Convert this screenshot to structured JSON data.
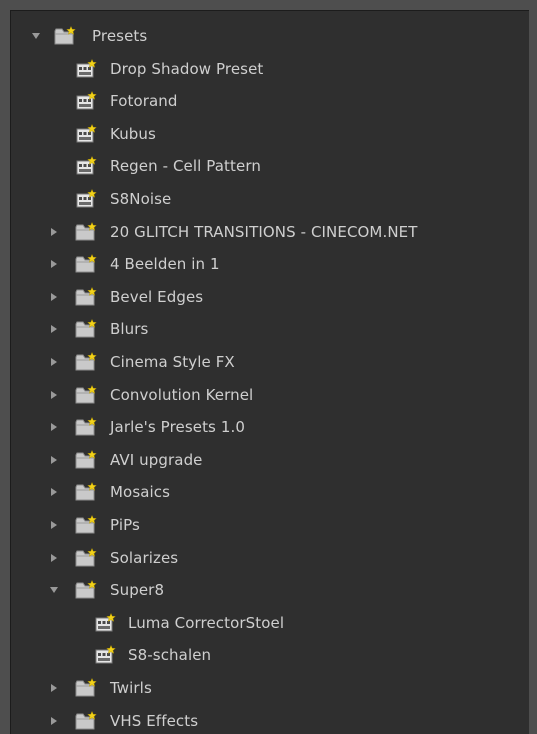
{
  "colors": {
    "panel_bg": "#2f2f2f",
    "text": "#cfcfcf",
    "folder": "#c9c9c9",
    "star": "#f2d21b",
    "twisty": "#9a9a9a"
  },
  "tree": [
    {
      "label": "Presets",
      "level": 0,
      "type": "folder",
      "expanded": true,
      "icon": "folder-star-icon"
    },
    {
      "label": "Drop Shadow Preset",
      "level": 1,
      "type": "preset",
      "icon": "preset-icon"
    },
    {
      "label": "Fotorand",
      "level": 1,
      "type": "preset",
      "icon": "preset-icon"
    },
    {
      "label": "Kubus",
      "level": 1,
      "type": "preset",
      "icon": "preset-icon"
    },
    {
      "label": "Regen - Cell Pattern",
      "level": 1,
      "type": "preset",
      "icon": "preset-icon"
    },
    {
      "label": "S8Noise",
      "level": 1,
      "type": "preset",
      "icon": "preset-icon"
    },
    {
      "label": "20 GLITCH TRANSITIONS - CINECOM.NET",
      "level": 1,
      "type": "folder",
      "expanded": false,
      "icon": "folder-star-icon"
    },
    {
      "label": "4 Beelden in 1",
      "level": 1,
      "type": "folder",
      "expanded": false,
      "icon": "folder-star-icon"
    },
    {
      "label": "Bevel Edges",
      "level": 1,
      "type": "folder",
      "expanded": false,
      "icon": "folder-star-icon"
    },
    {
      "label": "Blurs",
      "level": 1,
      "type": "folder",
      "expanded": false,
      "icon": "folder-star-icon"
    },
    {
      "label": "Cinema Style FX",
      "level": 1,
      "type": "folder",
      "expanded": false,
      "icon": "folder-star-icon"
    },
    {
      "label": "Convolution Kernel",
      "level": 1,
      "type": "folder",
      "expanded": false,
      "icon": "folder-star-icon"
    },
    {
      "label": "Jarle's Presets 1.0",
      "level": 1,
      "type": "folder",
      "expanded": false,
      "icon": "folder-star-icon"
    },
    {
      "label": "AVI upgrade",
      "level": 1,
      "type": "folder",
      "expanded": false,
      "icon": "folder-star-icon"
    },
    {
      "label": "Mosaics",
      "level": 1,
      "type": "folder",
      "expanded": false,
      "icon": "folder-star-icon"
    },
    {
      "label": "PiPs",
      "level": 1,
      "type": "folder",
      "expanded": false,
      "icon": "folder-star-icon"
    },
    {
      "label": "Solarizes",
      "level": 1,
      "type": "folder",
      "expanded": false,
      "icon": "folder-star-icon"
    },
    {
      "label": "Super8",
      "level": 1,
      "type": "folder",
      "expanded": true,
      "icon": "folder-star-icon"
    },
    {
      "label": "Luma CorrectorStoel",
      "level": 2,
      "type": "preset",
      "icon": "preset-icon"
    },
    {
      "label": "S8-schalen",
      "level": 2,
      "type": "preset",
      "icon": "preset-icon"
    },
    {
      "label": "Twirls",
      "level": 1,
      "type": "folder",
      "expanded": false,
      "icon": "folder-star-icon"
    },
    {
      "label": "VHS Effects",
      "level": 1,
      "type": "folder",
      "expanded": false,
      "icon": "folder-star-icon"
    }
  ]
}
